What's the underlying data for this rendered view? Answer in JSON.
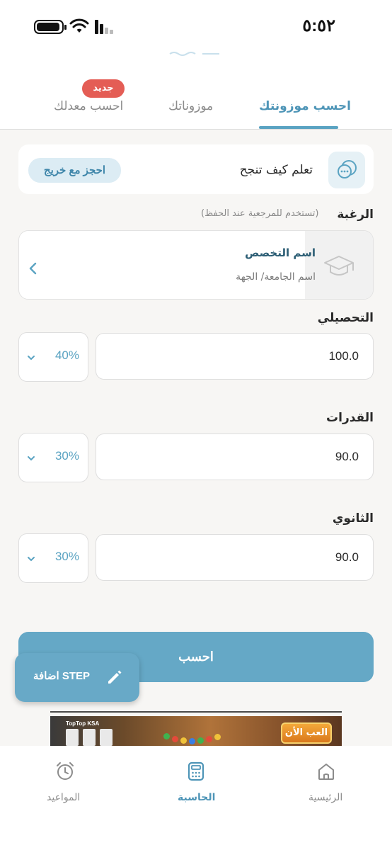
{
  "status_bar": {
    "time": "٥:٥٢"
  },
  "tabs": [
    {
      "label": "احسب موزونتك",
      "active": true
    },
    {
      "label": "موزوناتك",
      "active": false
    },
    {
      "label": "احسب معدلك",
      "active": false,
      "badge": "جديد"
    }
  ],
  "learn_card": {
    "text": "تعلم كيف تنجح",
    "button": "احجز مع خريج"
  },
  "desire": {
    "label": "الرغبة",
    "hint": "(تستخدم للمرجعية عند الحفظ)",
    "major_title": "اسم التخصص",
    "major_subtitle": "اسم الجامعة/ الجهة"
  },
  "fields": [
    {
      "label": "التحصيلي",
      "value": "100.0",
      "weight": "40%"
    },
    {
      "label": "القدرات",
      "value": "90.0",
      "weight": "30%"
    },
    {
      "label": "الثانوي",
      "value": "90.0",
      "weight": "30%"
    }
  ],
  "calculate_button": "احسب",
  "fab": {
    "label": "اضافة STEP"
  },
  "ad": {
    "brand": "TopTop KSA",
    "cta": "العب الأن"
  },
  "bottom_nav": [
    {
      "label": "الرئيسية",
      "icon": "home-icon",
      "active": false
    },
    {
      "label": "الحاسبة",
      "icon": "calculator-icon",
      "active": true
    },
    {
      "label": "المواعيد",
      "icon": "alarm-clock-icon",
      "active": false
    }
  ],
  "colors": {
    "accent": "#5aa3c2",
    "badge": "#e45d55",
    "background": "#f7f6f4"
  }
}
